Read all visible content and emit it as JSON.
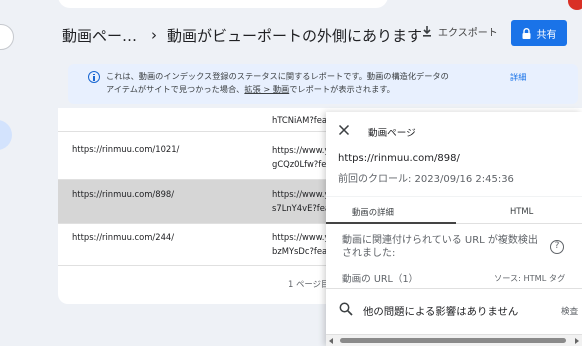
{
  "header": {
    "breadcrumb_root": "動画ペー…",
    "breadcrumb_sep": "›",
    "page_title": "動画がビューポートの外側にあります",
    "export_label": "エクスポート",
    "share_label": "共有"
  },
  "banner": {
    "text_1": "これは、動画のインデックス登録のステータスに関するレポートです。動画の構造化データの",
    "text_2a": "アイテムがサイトで見つかった場合、",
    "link": "拡張 > 動画",
    "text_2b": "でレポートが表示されます。",
    "detail_link": "詳細"
  },
  "table": {
    "rows": [
      {
        "url": "",
        "video_1": "hTCNiAM?fea",
        "video_2": ""
      },
      {
        "url": "https://rinmuu.com/1021/",
        "video_1": "https://www.y",
        "video_2": "gCQz0Lfw?fe"
      },
      {
        "url": "https://rinmuu.com/898/",
        "video_1": "https://www.y",
        "video_2": "s7LnY4vE?fea"
      },
      {
        "url": "https://rinmuu.com/244/",
        "video_1": "https://www.y",
        "video_2": "bzMYsDc?fea"
      }
    ],
    "pager": "1 ページ目"
  },
  "panel": {
    "title": "動画ページ",
    "url": "https://rinmuu.com/898/",
    "last_crawl": "前回のクロール: 2023/09/16 2:45:36",
    "tab_details": "動画の詳細",
    "tab_html": "HTML",
    "related_label": "動画に関連付けられている URL が複数検出されました:",
    "help_glyph": "?",
    "video_url_label": "動画の URL（1）",
    "source_label": "ソース: HTML タグ",
    "no_issues": "他の問題による影響はありません",
    "inspect": "検査"
  },
  "colors": {
    "accent": "#1a73e8",
    "banner_bg": "#e8f0fe",
    "selected_row": "#d6d6d6"
  }
}
